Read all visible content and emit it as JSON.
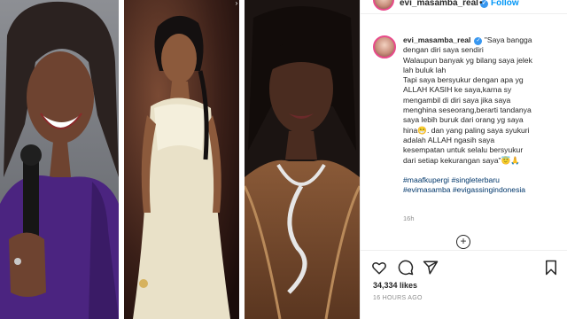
{
  "header": {
    "username": "evi_masamba_real",
    "verified_icon": "verified-badge-icon",
    "separator": "•",
    "follow_label": "Follow"
  },
  "caption": {
    "username": "evi_masamba_real",
    "lines": [
      "\"Saya bangga",
      "dengan diri saya sendiri",
      "Walaupun banyak yg bilang saya jelek",
      "lah buluk lah",
      "Tapi saya bersyukur dengan apa yg",
      "ALLAH KASIH ke saya,karna sy",
      "mengambil di diri saya jika saya",
      "menghina seseorang,berarti tandanya",
      "saya lebih buruk dari orang yg saya",
      "hina😁. dan yang paling saya syukuri",
      "adalah ALLAH ngasih saya",
      "kesempatan untuk selalu bersyukur",
      "dari setiap kekurangan saya\"😇🙏"
    ],
    "hashtags": [
      "#maafkupergi #singleterbaru",
      "#evimasamba #evigassingindonesia"
    ],
    "time_ago": "16h"
  },
  "actions": {
    "like_icon": "heart-icon",
    "comment_icon": "comment-icon",
    "share_icon": "share-icon",
    "save_icon": "bookmark-icon",
    "more_comments_icon": "plus-circle-icon",
    "more_comments_glyph": "+",
    "likes": "34,334 likes",
    "posted": "16 HOURS AGO"
  },
  "colors": {
    "accent": "#0095f6",
    "hashtag": "#00376b",
    "muted": "#8e8e8e",
    "text": "#262626"
  },
  "photos": [
    "woman-smiling-purple-dress",
    "woman-white-dress-stage",
    "woman-gold-jacket-snake-necklace"
  ],
  "carousel_next_glyph": "›"
}
